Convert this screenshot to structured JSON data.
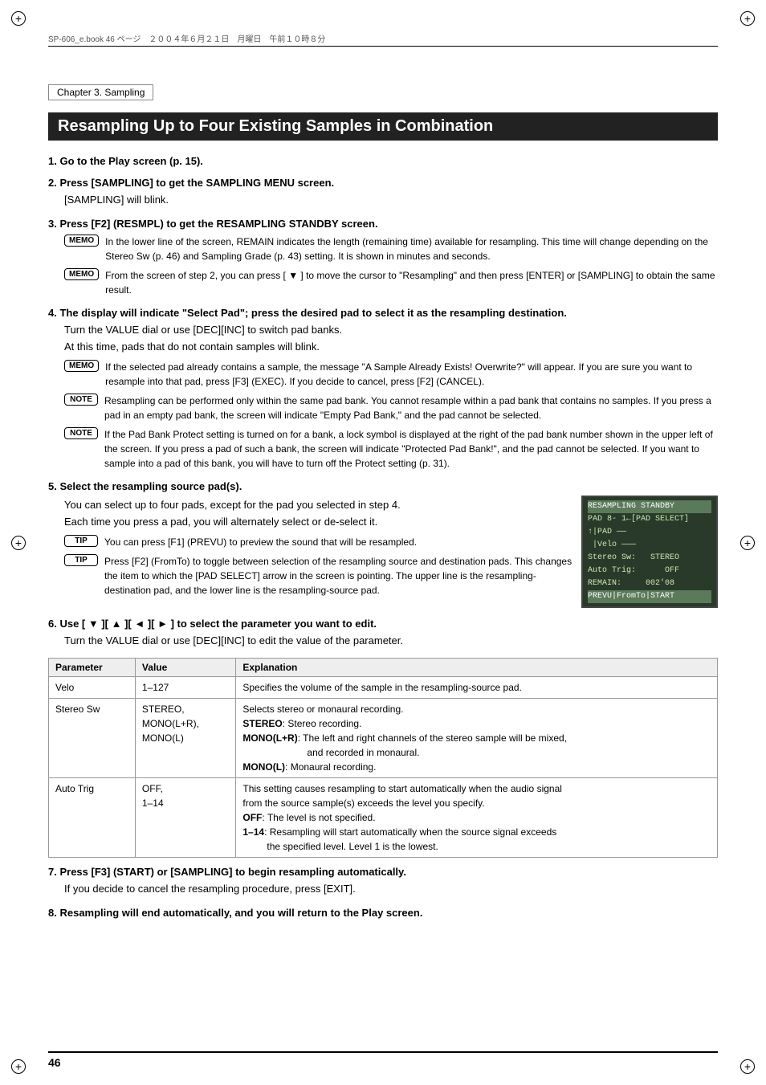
{
  "page": {
    "number": "46",
    "header_left": "SP-606_e.book 46 ページ　２００４年６月２１日　月曜日　午前１０時８分",
    "chapter": "Chapter 3. Sampling",
    "title": "Resampling Up to Four Existing Samples in Combination",
    "steps": [
      {
        "num": "1.",
        "header": "Go to the Play screen (p. 15).",
        "body": ""
      },
      {
        "num": "2.",
        "header": "Press [SAMPLING] to get the SAMPLING MENU screen.",
        "body": "[SAMPLING] will blink."
      },
      {
        "num": "3.",
        "header": "Press [F2] (RESMPL) to get the RESAMPLING STANDBY screen.",
        "body": "",
        "notes": [
          {
            "type": "MEMO",
            "text": "In the lower line of the screen, REMAIN indicates the length (remaining time) available for resampling. This time will change depending on the Stereo Sw (p. 46) and Sampling Grade (p. 43) setting. It is shown in minutes and seconds."
          },
          {
            "type": "MEMO",
            "text": "From the screen of step 2, you can press [ ▼ ] to move the cursor to \"Resampling\" and then press [ENTER] or [SAMPLING] to obtain the same result."
          }
        ]
      },
      {
        "num": "4.",
        "header": "The display will indicate \"Select Pad\"; press the desired pad to select it as the resampling destination.",
        "body_lines": [
          "Turn the VALUE dial or use [DEC][INC] to switch pad banks.",
          "At this time, pads that do not contain samples will blink."
        ],
        "notes": [
          {
            "type": "MEMO",
            "text": "If the selected pad already contains a sample, the message \"A Sample Already Exists! Overwrite?\" will appear. If you are sure you want to resample into that pad, press [F3] (EXEC). If you decide to cancel, press [F2] (CANCEL)."
          },
          {
            "type": "NOTE",
            "text": "Resampling can be performed only within the same pad bank. You cannot resample within a pad bank that contains no samples. If you press a pad in an empty pad bank, the screen will indicate \"Empty Pad Bank,\" and the pad cannot be selected."
          },
          {
            "type": "NOTE",
            "text": "If the Pad Bank Protect setting is turned on for a bank, a lock symbol is displayed at the right of the pad bank number shown in the upper left of the screen. If you press a pad of such a bank, the screen will indicate \"Protected Pad Bank!\", and the pad cannot be selected. If you want to sample into a pad of this bank, you will have to turn off the Protect setting (p. 31)."
          }
        ]
      },
      {
        "num": "5.",
        "header": "Select the resampling source pad(s).",
        "body_lines": [
          "You can select up to four pads, except for the pad you selected in step 4.",
          "Each time you press a pad, you will alternately select or de-select it."
        ],
        "tips": [
          {
            "type": "TIP",
            "text": "You can press [F1] (PREVU) to preview the sound that will be resampled."
          },
          {
            "type": "TIP",
            "text": "Press [F2] (FromTo) to toggle between selection of the resampling source and destination pads. This changes the item to which the [PAD SELECT] arrow in the screen is pointing. The upper line is the resampling-destination pad, and the lower line is the resampling-source pad."
          }
        ],
        "lcd": {
          "lines": [
            "RESAMPLING STANDBY",
            "PAD 8- 1←[PAD SELECT]",
            "↑|PAD ——",
            " |Velo ———",
            "Stereo Sw:   STEREO",
            "Auto Trig:      OFF",
            "REMAIN:     002'08",
            "PREVU|FromTo|START"
          ]
        }
      },
      {
        "num": "6.",
        "header": "Use [ ▼ ][ ▲ ][ ◄ ][ ► ] to select the parameter you want to edit.",
        "body": "Turn the VALUE dial or use [DEC][INC] to edit the value of the parameter."
      }
    ],
    "table": {
      "headers": [
        "Parameter",
        "Value",
        "Explanation"
      ],
      "rows": [
        {
          "param": "Velo",
          "value": "1–127",
          "explanation": "Specifies the volume of the sample in the resampling-source pad."
        },
        {
          "param": "Stereo Sw",
          "value": "STEREO,\nMONO(L+R),\nMONO(L)",
          "explanation_lines": [
            "Selects stereo or monaural recording.",
            "STEREO: Stereo recording.",
            "MONO(L+R): The left and right channels of the stereo sample will be mixed, and recorded in monaural.",
            "MONO(L): Monaural recording."
          ]
        },
        {
          "param": "Auto Trig",
          "value": "OFF,\n1–14",
          "explanation_lines": [
            "This setting causes resampling to start automatically when the audio signal from the source sample(s) exceeds the level you specify.",
            "OFF: The level is not specified.",
            "1–14: Resampling will start automatically when the source signal exceeds the specified level. Level 1 is the lowest."
          ]
        }
      ]
    },
    "steps_after_table": [
      {
        "num": "7.",
        "header": "Press [F3] (START) or [SAMPLING] to begin resampling automatically.",
        "body": "If you decide to cancel the resampling procedure, press [EXIT]."
      },
      {
        "num": "8.",
        "header": "Resampling will end automatically, and you will return to the Play screen.",
        "body": ""
      }
    ]
  }
}
